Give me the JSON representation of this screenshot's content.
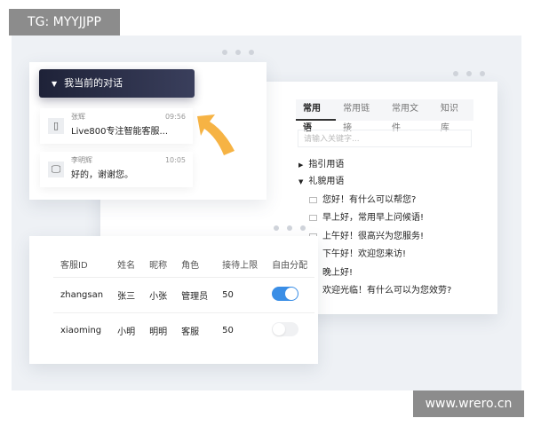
{
  "watermark_top": "TG: MYYJJPP",
  "watermark_bottom": "www.wrero.cn",
  "conversations": {
    "title": "我当前的对话",
    "items": [
      {
        "name": "张辉",
        "message": "Live800专注智能客服...",
        "time": "09:56",
        "icon": "mobile-icon"
      },
      {
        "name": "李明辉",
        "message": "好的，谢谢您。",
        "time": "10:05",
        "icon": "desktop-icon"
      }
    ]
  },
  "quick": {
    "tabs": [
      "常用语",
      "常用链接",
      "常用文件",
      "知识库"
    ],
    "active_tab": 0,
    "search_placeholder": "请输入关键字...",
    "groups": [
      {
        "label": "指引用语",
        "expanded": false
      },
      {
        "label": "礼貌用语",
        "expanded": true
      }
    ],
    "phrases": [
      "您好！有什么可以帮您?",
      "早上好，常用早上问候语!",
      "上午好！很高兴为您服务!",
      "下午好！欢迎您来访!",
      "晚上好!",
      "欢迎光临！有什么可以为您效劳?"
    ]
  },
  "agents": {
    "headers": [
      "客服ID",
      "姓名",
      "昵称",
      "角色",
      "接待上限",
      "自由分配"
    ],
    "rows": [
      {
        "id": "zhangsan",
        "name": "张三",
        "nick": "小张",
        "role": "管理员",
        "limit": "50",
        "auto": true
      },
      {
        "id": "xiaoming",
        "name": "小明",
        "nick": "明明",
        "role": "客服",
        "limit": "50",
        "auto": false
      }
    ]
  },
  "colors": {
    "accent": "#3a8ee6",
    "arrow": "#f5a623",
    "header": "#23273d"
  }
}
